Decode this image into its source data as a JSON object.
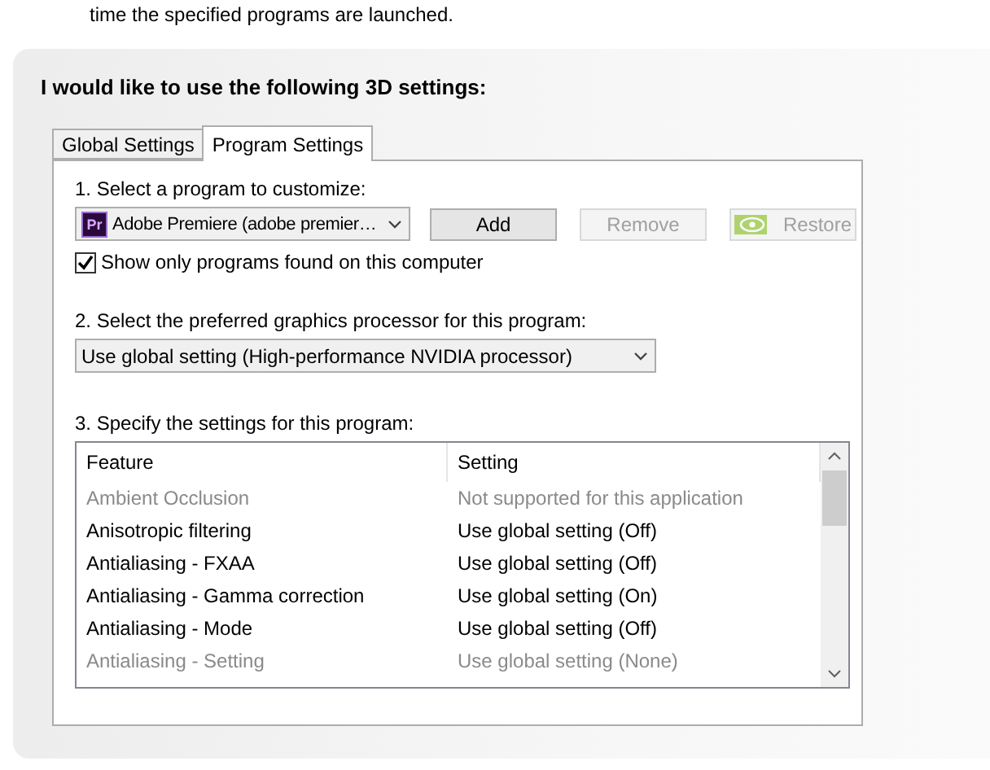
{
  "intro_text": "time the specified programs are launched.",
  "heading": "I would like to use the following 3D settings:",
  "tabs": [
    {
      "label": "Global Settings",
      "selected": false
    },
    {
      "label": "Program Settings",
      "selected": true
    }
  ],
  "step1": {
    "label": "1. Select a program to customize:",
    "program": "Adobe Premiere (adobe premier…",
    "program_icon": "Pr",
    "buttons": [
      {
        "label": "Add",
        "disabled": false,
        "kind": "plain"
      },
      {
        "label": "Remove",
        "disabled": true,
        "kind": "plain"
      },
      {
        "label": "Restore",
        "disabled": true,
        "kind": "logo"
      }
    ],
    "checkbox": {
      "label": "Show only programs found on this computer",
      "checked": true
    }
  },
  "step2": {
    "label": "2. Select the preferred graphics processor for this program:",
    "value": "Use global setting (High-performance NVIDIA processor)"
  },
  "step3": {
    "label": "3. Specify the settings for this program:",
    "table": {
      "columns": [
        "Feature",
        "Setting"
      ],
      "rows": [
        {
          "feature": "Ambient Occlusion",
          "setting": "Not supported for this application",
          "disabled": true
        },
        {
          "feature": "Anisotropic filtering",
          "setting": "Use global setting (Off)",
          "disabled": false
        },
        {
          "feature": "Antialiasing - FXAA",
          "setting": "Use global setting (Off)",
          "disabled": false
        },
        {
          "feature": "Antialiasing - Gamma correction",
          "setting": "Use global setting (On)",
          "disabled": false
        },
        {
          "feature": "Antialiasing - Mode",
          "setting": "Use global setting (Off)",
          "disabled": false
        },
        {
          "feature": "Antialiasing - Setting",
          "setting": "Use global setting (None)",
          "disabled": true
        }
      ]
    }
  }
}
